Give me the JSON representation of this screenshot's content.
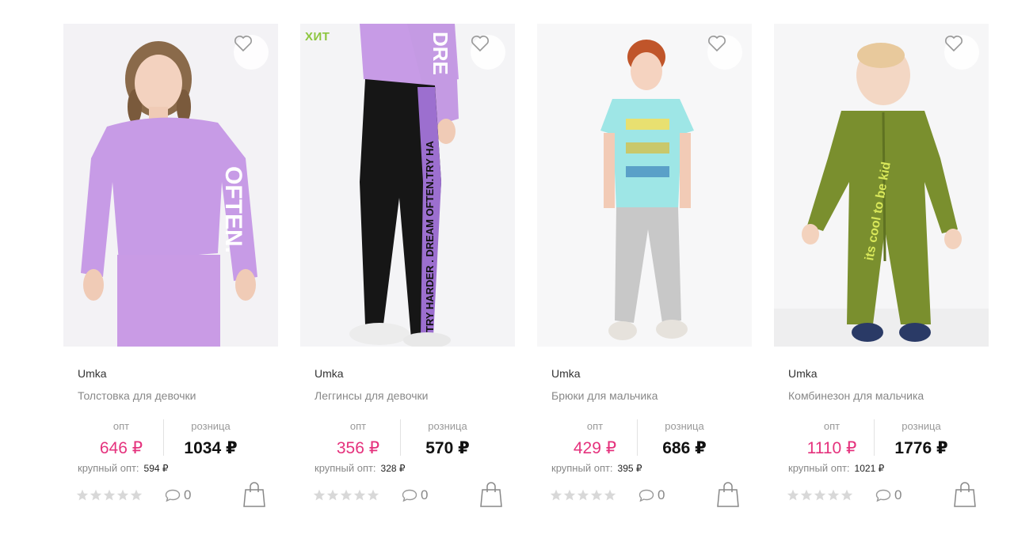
{
  "products": [
    {
      "brand": "Umka",
      "title": "Толстовка для девочки",
      "opt_label": "опт",
      "opt_price": "646 ₽",
      "retail_label": "розница",
      "retail_price": "1034 ₽",
      "bulk_label": "крупный опт:",
      "bulk_price": "594 ₽",
      "comments": "0",
      "badge": "",
      "image": "girl in lilac sweatshirt"
    },
    {
      "brand": "Umka",
      "title": "Леггинсы для девочки",
      "opt_label": "опт",
      "opt_price": "356 ₽",
      "retail_label": "розница",
      "retail_price": "570 ₽",
      "bulk_label": "крупный опт:",
      "bulk_price": "328 ₽",
      "comments": "0",
      "badge": "ХИТ",
      "image": "black leggings with lilac stripe"
    },
    {
      "brand": "Umka",
      "title": "Брюки для мальчика",
      "opt_label": "опт",
      "opt_price": "429 ₽",
      "retail_label": "розница",
      "retail_price": "686 ₽",
      "bulk_label": "крупный опт:",
      "bulk_price": "395 ₽",
      "comments": "0",
      "badge": "",
      "image": "boy in mint t-shirt and grey trousers"
    },
    {
      "brand": "Umka",
      "title": "Комбинезон для мальчика",
      "opt_label": "опт",
      "opt_price": "1110 ₽",
      "retail_label": "розница",
      "retail_price": "1776 ₽",
      "bulk_label": "крупный опт:",
      "bulk_price": "1021 ₽",
      "comments": "0",
      "badge": "",
      "image": "baby in olive green jumpsuit"
    }
  ],
  "icons": {
    "favorite": "heart-outline-icon",
    "rating": "star-icon",
    "comment": "speech-bubble-icon",
    "cart": "shopping-bag-icon"
  },
  "colors": {
    "opt_price": "#e5327d",
    "retail_price": "#111111",
    "badge": "#8dc63f",
    "star": "#d8d8d8"
  }
}
